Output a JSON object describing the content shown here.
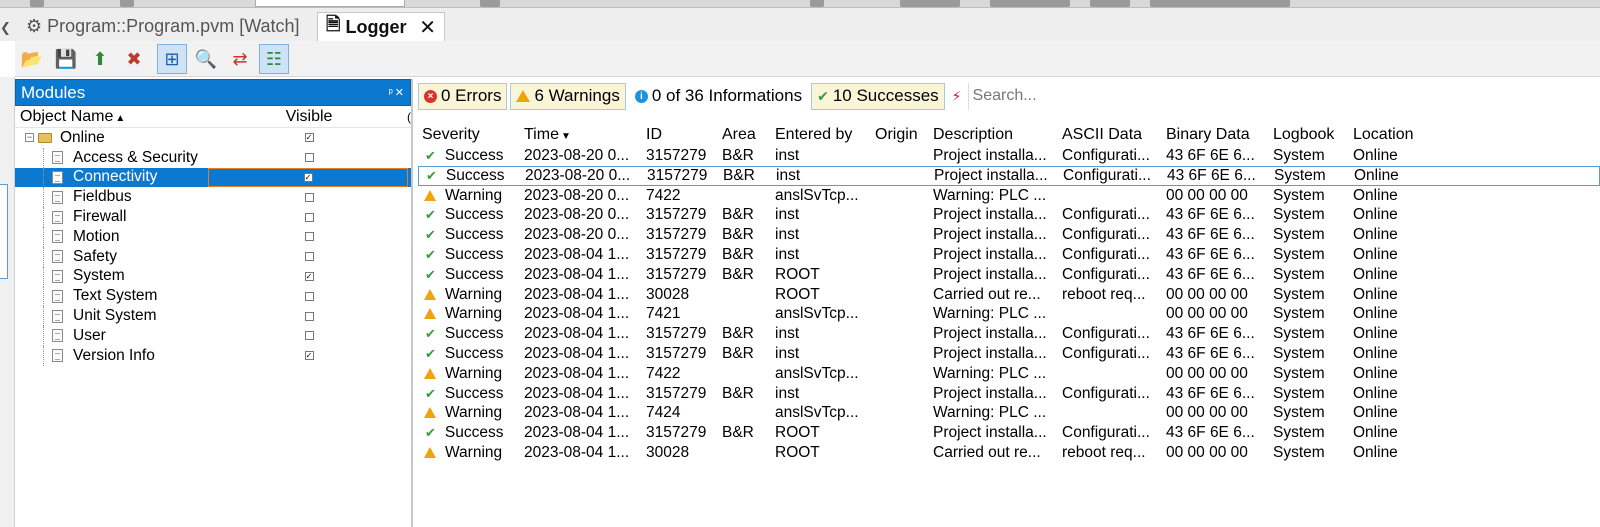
{
  "tabs": [
    {
      "label": "Program::Program.pvm [Watch]",
      "active": false
    },
    {
      "label": "Logger",
      "active": true
    }
  ],
  "toolbar": {
    "buttons": [
      "open-icon",
      "save-icon",
      "export-icon",
      "delete-icon",
      "tree-expand-icon",
      "search-icon",
      "merge-icon",
      "tree-view-icon"
    ]
  },
  "modules": {
    "title": "Modules",
    "col_name": "Object Name",
    "col_visible": "Visible",
    "root": {
      "label": "Online",
      "visible": true
    },
    "items": [
      {
        "label": "Access & Security",
        "visible": false
      },
      {
        "label": "Connectivity",
        "visible": true,
        "selected": true
      },
      {
        "label": "Fieldbus",
        "visible": false
      },
      {
        "label": "Firewall",
        "visible": false
      },
      {
        "label": "Motion",
        "visible": false
      },
      {
        "label": "Safety",
        "visible": false
      },
      {
        "label": "System",
        "visible": true
      },
      {
        "label": "Text System",
        "visible": false
      },
      {
        "label": "Unit System",
        "visible": false
      },
      {
        "label": "User",
        "visible": false
      },
      {
        "label": "Version Info",
        "visible": true
      }
    ]
  },
  "filters": {
    "errors": "0 Errors",
    "warnings": "6 Warnings",
    "informations": "0 of 36 Informations",
    "successes": "10 Successes",
    "search_placeholder": "Search..."
  },
  "grid": {
    "columns": [
      "Severity",
      "Time",
      "ID",
      "Area",
      "Entered by",
      "Origin",
      "Description",
      "ASCII Data",
      "Binary Data",
      "Logbook",
      "Location"
    ],
    "rows": [
      [
        "Success",
        "2023-08-20 0...",
        "3157279",
        "B&R",
        "inst",
        "",
        "Project installa...",
        "Configurati...",
        "43 6F 6E 6...",
        "System",
        "Online"
      ],
      [
        "Success",
        "2023-08-20 0...",
        "3157279",
        "B&R",
        "inst",
        "",
        "Project installa...",
        "Configurati...",
        "43 6F 6E 6...",
        "System",
        "Online"
      ],
      [
        "Warning",
        "2023-08-20 0...",
        "7422",
        "",
        "anslSvTcp...",
        "",
        "Warning: PLC ...",
        "",
        "00 00 00 00",
        "System",
        "Online"
      ],
      [
        "Success",
        "2023-08-20 0...",
        "3157279",
        "B&R",
        "inst",
        "",
        "Project installa...",
        "Configurati...",
        "43 6F 6E 6...",
        "System",
        "Online"
      ],
      [
        "Success",
        "2023-08-20 0...",
        "3157279",
        "B&R",
        "inst",
        "",
        "Project installa...",
        "Configurati...",
        "43 6F 6E 6...",
        "System",
        "Online"
      ],
      [
        "Success",
        "2023-08-04 1...",
        "3157279",
        "B&R",
        "inst",
        "",
        "Project installa...",
        "Configurati...",
        "43 6F 6E 6...",
        "System",
        "Online"
      ],
      [
        "Success",
        "2023-08-04 1...",
        "3157279",
        "B&R",
        "ROOT",
        "",
        "Project installa...",
        "Configurati...",
        "43 6F 6E 6...",
        "System",
        "Online"
      ],
      [
        "Warning",
        "2023-08-04 1...",
        "30028",
        "",
        "ROOT",
        "",
        "Carried out re...",
        "reboot req...",
        "00 00 00 00",
        "System",
        "Online"
      ],
      [
        "Warning",
        "2023-08-04 1...",
        "7421",
        "",
        "anslSvTcp...",
        "",
        "Warning: PLC ...",
        "",
        "00 00 00 00",
        "System",
        "Online"
      ],
      [
        "Success",
        "2023-08-04 1...",
        "3157279",
        "B&R",
        "inst",
        "",
        "Project installa...",
        "Configurati...",
        "43 6F 6E 6...",
        "System",
        "Online"
      ],
      [
        "Success",
        "2023-08-04 1...",
        "3157279",
        "B&R",
        "inst",
        "",
        "Project installa...",
        "Configurati...",
        "43 6F 6E 6...",
        "System",
        "Online"
      ],
      [
        "Warning",
        "2023-08-04 1...",
        "7422",
        "",
        "anslSvTcp...",
        "",
        "Warning: PLC ...",
        "",
        "00 00 00 00",
        "System",
        "Online"
      ],
      [
        "Success",
        "2023-08-04 1...",
        "3157279",
        "B&R",
        "inst",
        "",
        "Project installa...",
        "Configurati...",
        "43 6F 6E 6...",
        "System",
        "Online"
      ],
      [
        "Warning",
        "2023-08-04 1...",
        "7424",
        "",
        "anslSvTcp...",
        "",
        "Warning: PLC ...",
        "",
        "00 00 00 00",
        "System",
        "Online"
      ],
      [
        "Success",
        "2023-08-04 1...",
        "3157279",
        "B&R",
        "ROOT",
        "",
        "Project installa...",
        "Configurati...",
        "43 6F 6E 6...",
        "System",
        "Online"
      ],
      [
        "Warning",
        "2023-08-04 1...",
        "30028",
        "",
        "ROOT",
        "",
        "Carried out re...",
        "reboot req...",
        "00 00 00 00",
        "System",
        "Online"
      ]
    ],
    "selected_row": 1
  },
  "colors": {
    "accent": "#0b79d0",
    "success": "#3a9a3a",
    "warning": "#f0a30a",
    "error": "#d9342b"
  }
}
